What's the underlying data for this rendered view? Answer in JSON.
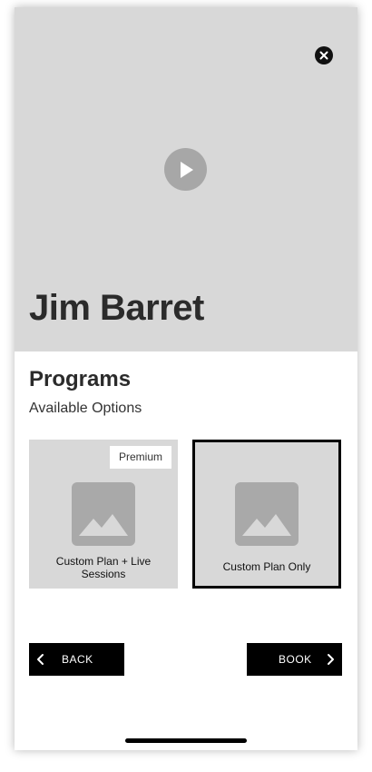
{
  "hero": {
    "title": "Jim Barret",
    "play_icon": "play-icon",
    "close_icon": "close-icon"
  },
  "programs": {
    "title": "Programs",
    "subtitle": "Available Options",
    "options": [
      {
        "label": "Custom Plan + Live Sessions",
        "badge": "Premium",
        "selected": false,
        "icon": "image-placeholder-icon"
      },
      {
        "label": "Custom Plan Only",
        "selected": true,
        "icon": "image-placeholder-icon"
      }
    ]
  },
  "navigation": {
    "back_label": "BACK",
    "back_icon": "chevron-left-icon",
    "book_label": "BOOK",
    "book_icon": "chevron-right-icon"
  },
  "colors": {
    "placeholder_bg": "#d8d8d8",
    "placeholder_fg": "#a9a9a9",
    "button_bg": "#000000",
    "button_fg": "#ffffff",
    "selected_border": "#000000"
  }
}
